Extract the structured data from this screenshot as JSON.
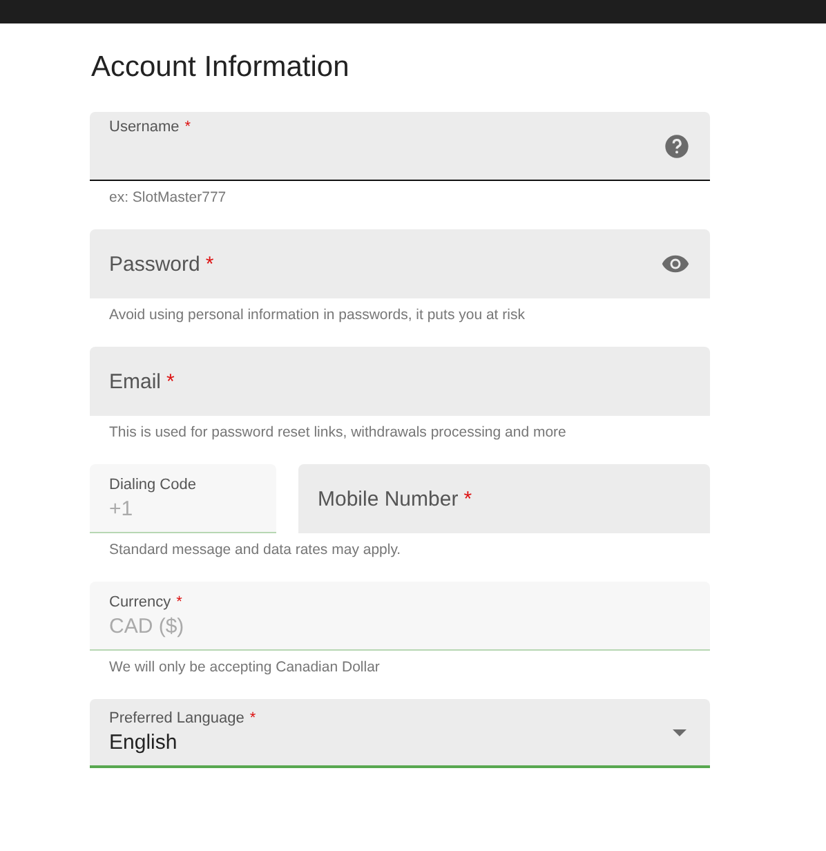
{
  "title": "Account Information",
  "rows": [
    {
      "fields": [
        {
          "kind": "text",
          "label": "Username",
          "required": "*",
          "focused": true,
          "help_icon": true
        }
      ],
      "hint": "ex: SlotMaster777"
    },
    {
      "fields": [
        {
          "kind": "text",
          "label": "Password",
          "required": "*",
          "focused": false,
          "reveal_icon": true
        }
      ],
      "hint": "Avoid using personal information in passwords, it puts you at risk"
    },
    {
      "fields": [
        {
          "kind": "text",
          "label": "Email",
          "required": "*",
          "focused": false
        }
      ],
      "hint": "This is used for password reset links, withdrawals processing and more"
    },
    {
      "fields": [
        {
          "kind": "text",
          "label": "Dialing Code",
          "value": "+1",
          "disabled": true,
          "narrow": true
        },
        {
          "kind": "text",
          "label": "Mobile Number",
          "required": "*",
          "focused": false
        }
      ],
      "hint": "Standard message and data rates may apply."
    },
    {
      "fields": [
        {
          "kind": "text",
          "label": "Currency",
          "required": "*",
          "value": "CAD ($)",
          "disabled": true
        }
      ],
      "hint": "We will only be accepting Canadian Dollar"
    },
    {
      "fields": [
        {
          "kind": "select",
          "label": "Preferred Language",
          "required": "*",
          "value": "English"
        }
      ]
    }
  ]
}
